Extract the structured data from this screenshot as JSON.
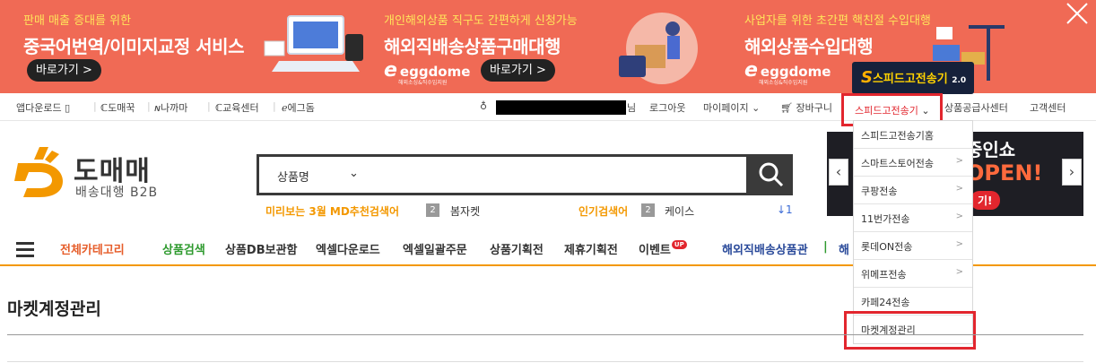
{
  "banner": {
    "promo1": {
      "sub": "판매 매출 증대를 위한",
      "main": "중국어번역/이미지교정 서비스",
      "go": "바로가기 >"
    },
    "promo2": {
      "sub": "개인해외상품 직구도 간편하게 신청가능",
      "main": "해외직배송상품구매대행",
      "go": "바로가기 >",
      "brand": "eggdome",
      "brand_small": "해외소싱&직수입지원"
    },
    "promo3": {
      "sub": "사업자를 위한 초간편 핵친절 수입대행",
      "main": "해외상품수입대행",
      "go": "바로가기 >",
      "brand": "eggdome",
      "brand_small": "해외소싱&직수입지원"
    },
    "speed_logo": {
      "s": "S",
      "text": "스피드고전송기",
      "version": "2.0"
    }
  },
  "util": {
    "app_download": "앱다운로드",
    "domeggook": "도매꾹",
    "nakkama": "나까마",
    "edu": "교육센터",
    "eggdome": "에그돔",
    "user_suffix": "님",
    "logout": "로그아웃",
    "mypage": "마이페이지",
    "cart": "장바구니",
    "speed": "스피드고전송기",
    "supplier": "상품공급사센터",
    "cs": "고객센터"
  },
  "logo": {
    "name": "도매매",
    "sub": "배송대행 B2B"
  },
  "search": {
    "category": "상품명",
    "md_label": "미리보는 3월 MD추천검색어",
    "md_num": "2",
    "md_word": "봄자켓",
    "pop_label": "인기검색어",
    "pop_num": "2",
    "pop_word": "케이스",
    "rank_change": "↓1"
  },
  "gnb": {
    "all_category": "전체카테고리",
    "items": [
      "상품검색",
      "상품DB보관함",
      "엑셀다운로드",
      "엑셀일괄주문",
      "상품기획전",
      "제휴기획전",
      "이벤트"
    ],
    "event_badge": "UP",
    "overseas": "해외직배송상품관",
    "overseas_more": "해"
  },
  "side_banner": {
    "t1": "중인쇼",
    "t2": "OPEN!",
    "t3": "기!"
  },
  "dropdown": {
    "items": [
      {
        "label": "스피드고전송기홈",
        "arrow": ""
      },
      {
        "label": "스마트스토어전송",
        "arrow": ">"
      },
      {
        "label": "쿠팡전송",
        "arrow": ">"
      },
      {
        "label": "11번가전송",
        "arrow": ">"
      },
      {
        "label": "롯데ON전송",
        "arrow": ">"
      },
      {
        "label": "위메프전송",
        "arrow": ">"
      },
      {
        "label": "카페24전송",
        "arrow": ""
      },
      {
        "label": "마켓계정관리",
        "arrow": ""
      }
    ]
  },
  "page": {
    "title": "마켓계정관리"
  },
  "colors": {
    "banner": "#f06a55",
    "accent": "#f39800",
    "highlight": "#e2262e",
    "dark": "#3a3a3a"
  }
}
